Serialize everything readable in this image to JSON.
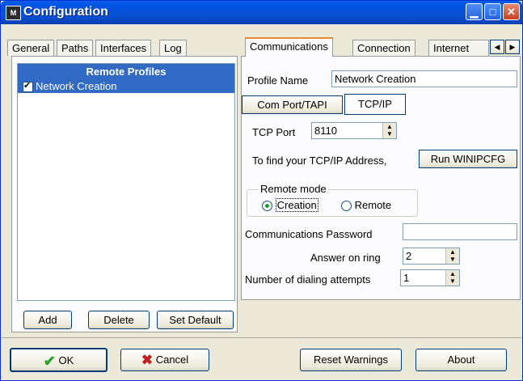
{
  "window": {
    "title": "Configuration",
    "icon_text": "M"
  },
  "left_tabs": [
    "General",
    "Paths",
    "Interfaces",
    "Log"
  ],
  "right_tabs": [
    "Communications",
    "Connection",
    "Internet"
  ],
  "tab_scroll": {
    "left": "◀",
    "right": "▶"
  },
  "profiles": {
    "header": "Remote Profiles",
    "items": [
      {
        "label": "Network Creation",
        "checked": true
      }
    ],
    "add_label": "Add",
    "delete_label": "Delete",
    "set_default_label": "Set Default"
  },
  "comm": {
    "profile_name_label": "Profile Name",
    "profile_name_value": "Network Creation",
    "subtabs": [
      "Com Port/TAPI",
      "TCP/IP"
    ],
    "tcp_port_label": "TCP Port",
    "tcp_port_value": "8110",
    "find_ip_label": "To find your TCP/IP Address,",
    "run_winipcfg_label": "Run WINIPCFG",
    "remote_mode_label": "Remote mode",
    "mode_creation": "Creation",
    "mode_remote": "Remote",
    "password_label": "Communications Password",
    "password_value": "",
    "answer_ring_label": "Answer on ring",
    "answer_ring_value": "2",
    "dial_attempts_label": "Number of dialing attempts",
    "dial_attempts_value": "1"
  },
  "footer": {
    "ok_label": "OK",
    "cancel_label": "Cancel",
    "reset_warnings_label": "Reset Warnings",
    "about_label": "About"
  },
  "colors": {
    "titlebar": "#0054e3",
    "selection": "#316ac5",
    "ok_check": "#2aa02a",
    "cancel_x": "#c02020"
  }
}
